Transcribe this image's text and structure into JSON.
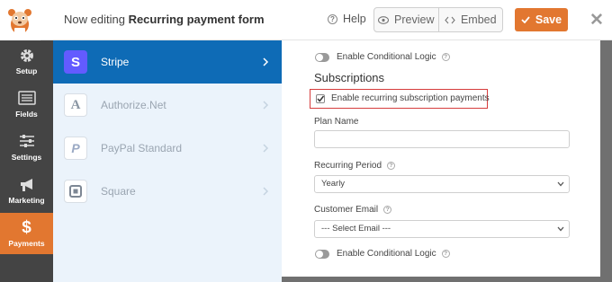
{
  "header": {
    "title_prefix": "Now editing",
    "form_name": "Recurring payment form",
    "help_label": "Help",
    "preview_label": "Preview",
    "embed_label": "Embed",
    "save_label": "Save"
  },
  "sidebar": {
    "items": [
      {
        "label": "Setup",
        "icon": "gear-icon"
      },
      {
        "label": "Fields",
        "icon": "fields-icon"
      },
      {
        "label": "Settings",
        "icon": "sliders-icon"
      },
      {
        "label": "Marketing",
        "icon": "megaphone-icon"
      },
      {
        "label": "Payments",
        "icon": "dollar-icon",
        "active": true
      }
    ]
  },
  "providers": [
    {
      "label": "Stripe",
      "active": true
    },
    {
      "label": "Authorize.Net"
    },
    {
      "label": "PayPal Standard"
    },
    {
      "label": "Square"
    }
  ],
  "settings": {
    "conditional_logic_top": "Enable Conditional Logic",
    "subscriptions_heading": "Subscriptions",
    "recurring_checkbox_label": "Enable recurring subscription payments",
    "recurring_checked": true,
    "plan_name_label": "Plan Name",
    "plan_name_value": "",
    "recurring_period_label": "Recurring Period",
    "recurring_period_value": "Yearly",
    "customer_email_label": "Customer Email",
    "customer_email_value": "--- Select Email ---",
    "conditional_logic_bottom": "Enable Conditional Logic"
  },
  "colors": {
    "accent": "#e27730",
    "stripe_blue": "#0e6bb6",
    "nav_bg": "#444444",
    "highlight_red": "#d63c3c"
  }
}
